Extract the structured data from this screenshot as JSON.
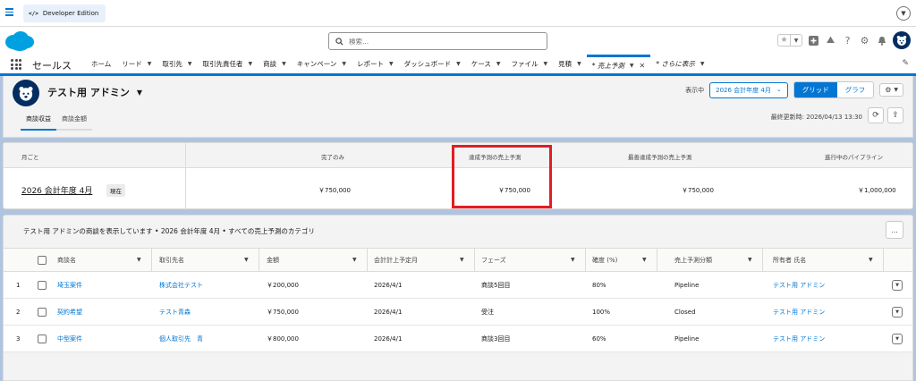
{
  "topbar": {
    "edition_code": "</>",
    "edition": "Developer Edition"
  },
  "header": {
    "search_placeholder": "検索..."
  },
  "nav": {
    "app_name": "セールス",
    "items": [
      {
        "label": "ホーム"
      },
      {
        "label": "リード"
      },
      {
        "label": "取引先"
      },
      {
        "label": "取引先責任者"
      },
      {
        "label": "商談"
      },
      {
        "label": "キャンペーン"
      },
      {
        "label": "レポート"
      },
      {
        "label": "ダッシュボード"
      },
      {
        "label": "ケース"
      },
      {
        "label": "ファイル"
      },
      {
        "label": "見積"
      }
    ],
    "active_tab": "* 売上予測",
    "more": "* さらに表示"
  },
  "page": {
    "title": "テスト用 アドミン",
    "tabs": [
      "商談収益",
      "商談金額"
    ],
    "display_label": "表示中",
    "period_select": "2026 会計年度 4月",
    "view_grid": "グリッド",
    "view_graph": "グラフ",
    "last_updated": "最終更新時: 2026/04/13 13:30"
  },
  "summary": {
    "headers": [
      "月ごと",
      "完了のみ",
      "達成予測の売上予測",
      "最善達成予測の売上予測",
      "進行中のパイプライン"
    ],
    "period": "2026 会計年度 4月",
    "badge": "現在",
    "values": [
      "￥750,000",
      "￥750,000",
      "￥750,000",
      "￥1,000,000"
    ]
  },
  "table": {
    "description": "テスト用 アドミンの商談を表示しています • 2026 会計年度 4月 • すべての売上予測のカテゴリ",
    "more_label": "...",
    "columns": [
      "商談名",
      "取引先名",
      "金額",
      "会計計上予定月",
      "フェーズ",
      "確度 (%)",
      "売上予測分類",
      "所有者 氏名"
    ],
    "rows": [
      {
        "num": "1",
        "name": "埼玉案件",
        "account": "株式会社テスト",
        "amount": "￥200,000",
        "close": "2026/4/1",
        "stage": "商談5回目",
        "prob": "80%",
        "category": "Pipeline",
        "owner": "テスト用 アドミン"
      },
      {
        "num": "2",
        "name": "契約希望",
        "account": "テスト青森",
        "amount": "￥750,000",
        "close": "2026/4/1",
        "stage": "受注",
        "prob": "100%",
        "category": "Closed",
        "owner": "テスト用 アドミン"
      },
      {
        "num": "3",
        "name": "中型案件",
        "account": "個人取引先　青",
        "amount": "￥800,000",
        "close": "2026/4/1",
        "stage": "商談3回目",
        "prob": "60%",
        "category": "Pipeline",
        "owner": "テスト用 アドミン"
      }
    ]
  },
  "colors": {
    "brand": "#0176d3",
    "highlight": "#e21d24",
    "navy": "#032d60"
  }
}
